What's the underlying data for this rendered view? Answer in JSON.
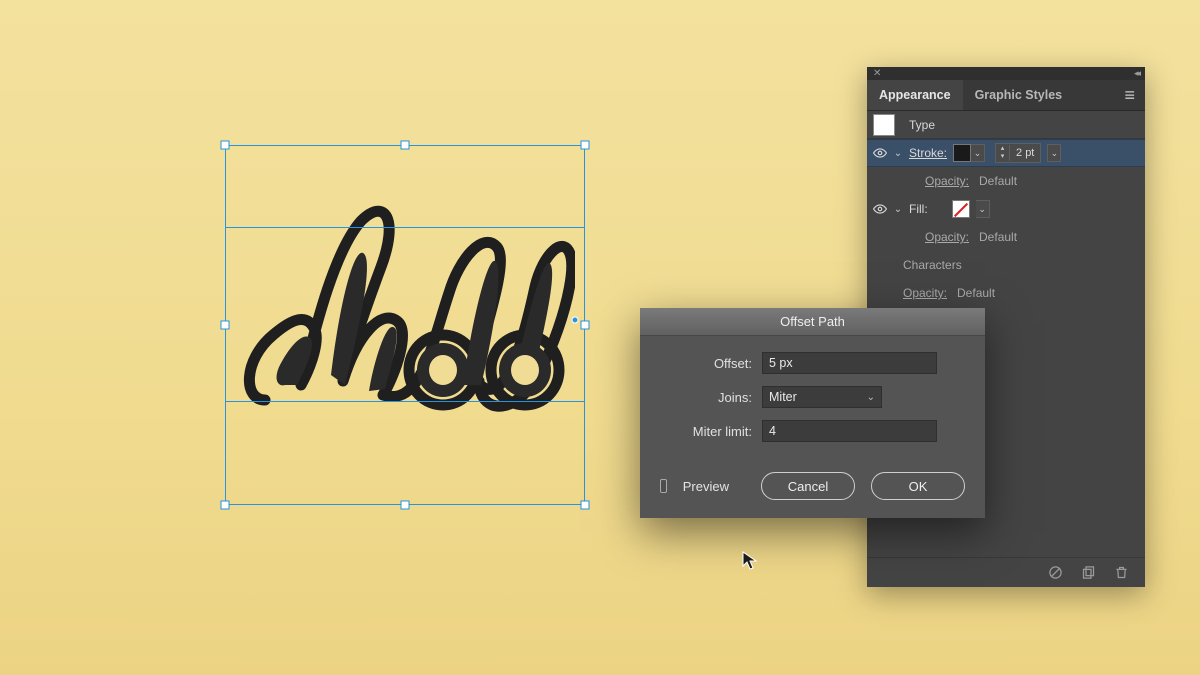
{
  "canvas": {
    "artwork_text": "hello"
  },
  "appearance_panel": {
    "tabs": {
      "appearance": "Appearance",
      "graphicStyles": "Graphic Styles"
    },
    "type_label": "Type",
    "stroke": {
      "label": "Stroke:",
      "weight": "2 pt",
      "color": "black"
    },
    "stroke_opacity": {
      "label": "Opacity:",
      "value": "Default"
    },
    "fill": {
      "label": "Fill:",
      "value": "none"
    },
    "fill_opacity": {
      "label": "Opacity:",
      "value": "Default"
    },
    "characters_label": "Characters",
    "global_opacity": {
      "label": "Opacity:",
      "value": "Default"
    }
  },
  "offset_dialog": {
    "title": "Offset Path",
    "offset_label": "Offset:",
    "offset_value": "5 px",
    "joins_label": "Joins:",
    "joins_value": "Miter",
    "miter_label": "Miter limit:",
    "miter_value": "4",
    "preview_label": "Preview",
    "preview_checked": false,
    "cancel_label": "Cancel",
    "ok_label": "OK"
  }
}
